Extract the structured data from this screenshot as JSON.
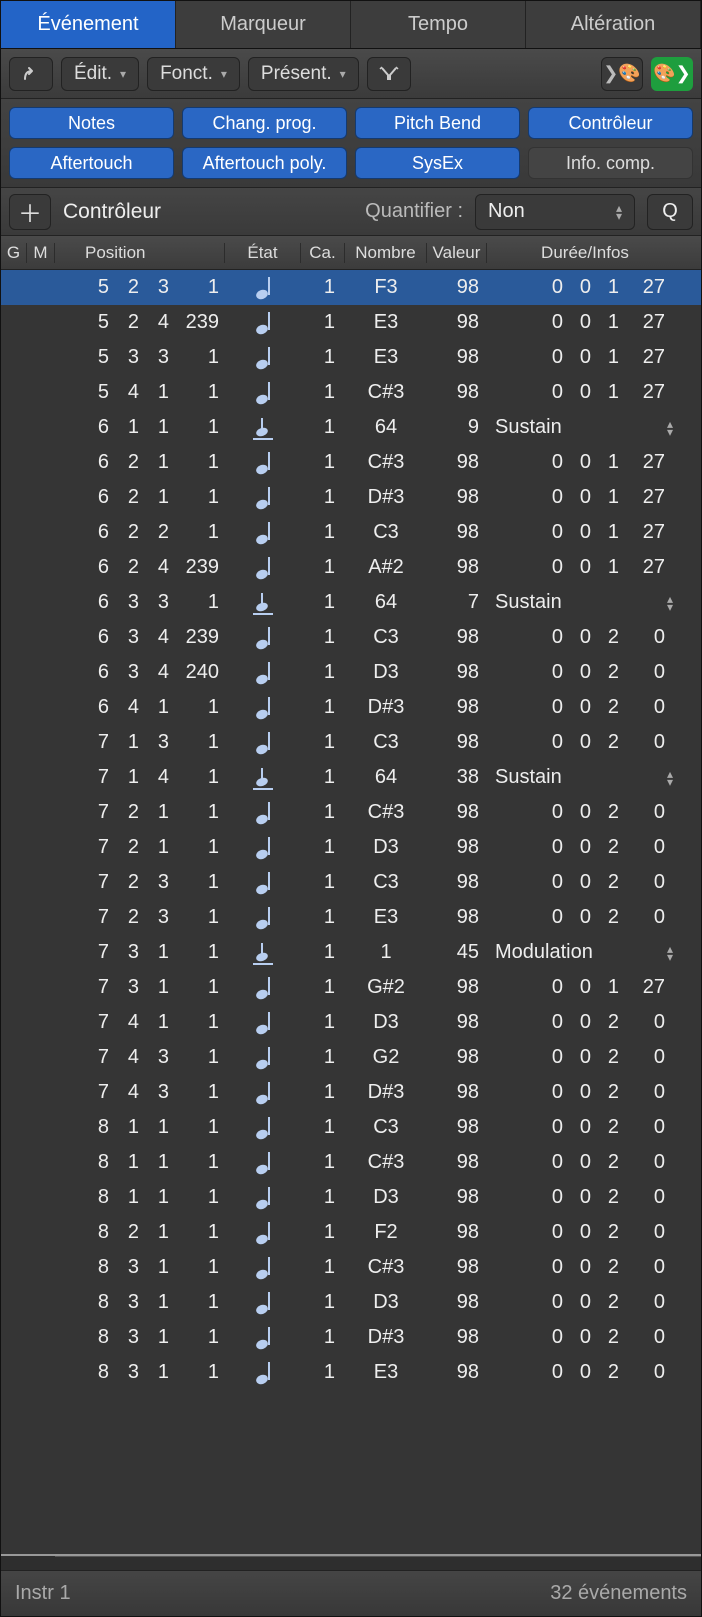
{
  "tabs": [
    "Événement",
    "Marqueur",
    "Tempo",
    "Altération"
  ],
  "toolbar": {
    "edit": "Édit.",
    "functions": "Fonct.",
    "present": "Présent."
  },
  "filters": {
    "notes": "Notes",
    "progchange": "Chang. prog.",
    "pitchbend": "Pitch Bend",
    "controller": "Contrôleur",
    "aftertouch": "Aftertouch",
    "polyafter": "Aftertouch poly.",
    "sysex": "SysEx",
    "infocomp": "Info. comp."
  },
  "add": {
    "type": "Contrôleur",
    "quant_label": "Quantifier :",
    "quant_value": "Non",
    "q": "Q"
  },
  "headers": {
    "g": "G",
    "m": "M",
    "pos": "Position",
    "etat": "État",
    "ca": "Ca.",
    "nom": "Nombre",
    "val": "Valeur",
    "dur": "Durée/Infos"
  },
  "events": [
    {
      "sel": true,
      "pos": [
        "5",
        "2",
        "3",
        "1"
      ],
      "type": "note",
      "ca": "1",
      "nom": "F3",
      "val": "98",
      "dur": [
        "0",
        "0",
        "1",
        "27"
      ]
    },
    {
      "pos": [
        "5",
        "2",
        "4",
        "239"
      ],
      "type": "note",
      "ca": "1",
      "nom": "E3",
      "val": "98",
      "dur": [
        "0",
        "0",
        "1",
        "27"
      ]
    },
    {
      "pos": [
        "5",
        "3",
        "3",
        "1"
      ],
      "type": "note",
      "ca": "1",
      "nom": "E3",
      "val": "98",
      "dur": [
        "0",
        "0",
        "1",
        "27"
      ]
    },
    {
      "pos": [
        "5",
        "4",
        "1",
        "1"
      ],
      "type": "note",
      "ca": "1",
      "nom": "C#3",
      "val": "98",
      "dur": [
        "0",
        "0",
        "1",
        "27"
      ]
    },
    {
      "pos": [
        "6",
        "1",
        "1",
        "1"
      ],
      "type": "ctrl",
      "ca": "1",
      "nom": "64",
      "val": "9",
      "info": "Sustain"
    },
    {
      "pos": [
        "6",
        "2",
        "1",
        "1"
      ],
      "type": "note",
      "ca": "1",
      "nom": "C#3",
      "val": "98",
      "dur": [
        "0",
        "0",
        "1",
        "27"
      ]
    },
    {
      "pos": [
        "6",
        "2",
        "1",
        "1"
      ],
      "type": "note",
      "ca": "1",
      "nom": "D#3",
      "val": "98",
      "dur": [
        "0",
        "0",
        "1",
        "27"
      ]
    },
    {
      "pos": [
        "6",
        "2",
        "2",
        "1"
      ],
      "type": "note",
      "ca": "1",
      "nom": "C3",
      "val": "98",
      "dur": [
        "0",
        "0",
        "1",
        "27"
      ]
    },
    {
      "pos": [
        "6",
        "2",
        "4",
        "239"
      ],
      "type": "note",
      "ca": "1",
      "nom": "A#2",
      "val": "98",
      "dur": [
        "0",
        "0",
        "1",
        "27"
      ]
    },
    {
      "pos": [
        "6",
        "3",
        "3",
        "1"
      ],
      "type": "ctrl",
      "ca": "1",
      "nom": "64",
      "val": "7",
      "info": "Sustain"
    },
    {
      "pos": [
        "6",
        "3",
        "4",
        "239"
      ],
      "type": "note",
      "ca": "1",
      "nom": "C3",
      "val": "98",
      "dur": [
        "0",
        "0",
        "2",
        "0"
      ]
    },
    {
      "pos": [
        "6",
        "3",
        "4",
        "240"
      ],
      "type": "note",
      "ca": "1",
      "nom": "D3",
      "val": "98",
      "dur": [
        "0",
        "0",
        "2",
        "0"
      ]
    },
    {
      "pos": [
        "6",
        "4",
        "1",
        "1"
      ],
      "type": "note",
      "ca": "1",
      "nom": "D#3",
      "val": "98",
      "dur": [
        "0",
        "0",
        "2",
        "0"
      ]
    },
    {
      "pos": [
        "7",
        "1",
        "3",
        "1"
      ],
      "type": "note",
      "ca": "1",
      "nom": "C3",
      "val": "98",
      "dur": [
        "0",
        "0",
        "2",
        "0"
      ]
    },
    {
      "pos": [
        "7",
        "1",
        "4",
        "1"
      ],
      "type": "ctrl",
      "ca": "1",
      "nom": "64",
      "val": "38",
      "info": "Sustain"
    },
    {
      "pos": [
        "7",
        "2",
        "1",
        "1"
      ],
      "type": "note",
      "ca": "1",
      "nom": "C#3",
      "val": "98",
      "dur": [
        "0",
        "0",
        "2",
        "0"
      ]
    },
    {
      "pos": [
        "7",
        "2",
        "1",
        "1"
      ],
      "type": "note",
      "ca": "1",
      "nom": "D3",
      "val": "98",
      "dur": [
        "0",
        "0",
        "2",
        "0"
      ]
    },
    {
      "pos": [
        "7",
        "2",
        "3",
        "1"
      ],
      "type": "note",
      "ca": "1",
      "nom": "C3",
      "val": "98",
      "dur": [
        "0",
        "0",
        "2",
        "0"
      ]
    },
    {
      "pos": [
        "7",
        "2",
        "3",
        "1"
      ],
      "type": "note",
      "ca": "1",
      "nom": "E3",
      "val": "98",
      "dur": [
        "0",
        "0",
        "2",
        "0"
      ]
    },
    {
      "pos": [
        "7",
        "3",
        "1",
        "1"
      ],
      "type": "ctrl",
      "ca": "1",
      "nom": "1",
      "val": "45",
      "info": "Modulation"
    },
    {
      "pos": [
        "7",
        "3",
        "1",
        "1"
      ],
      "type": "note",
      "ca": "1",
      "nom": "G#2",
      "val": "98",
      "dur": [
        "0",
        "0",
        "1",
        "27"
      ]
    },
    {
      "pos": [
        "7",
        "4",
        "1",
        "1"
      ],
      "type": "note",
      "ca": "1",
      "nom": "D3",
      "val": "98",
      "dur": [
        "0",
        "0",
        "2",
        "0"
      ]
    },
    {
      "pos": [
        "7",
        "4",
        "3",
        "1"
      ],
      "type": "note",
      "ca": "1",
      "nom": "G2",
      "val": "98",
      "dur": [
        "0",
        "0",
        "2",
        "0"
      ]
    },
    {
      "pos": [
        "7",
        "4",
        "3",
        "1"
      ],
      "type": "note",
      "ca": "1",
      "nom": "D#3",
      "val": "98",
      "dur": [
        "0",
        "0",
        "2",
        "0"
      ]
    },
    {
      "pos": [
        "8",
        "1",
        "1",
        "1"
      ],
      "type": "note",
      "ca": "1",
      "nom": "C3",
      "val": "98",
      "dur": [
        "0",
        "0",
        "2",
        "0"
      ]
    },
    {
      "pos": [
        "8",
        "1",
        "1",
        "1"
      ],
      "type": "note",
      "ca": "1",
      "nom": "C#3",
      "val": "98",
      "dur": [
        "0",
        "0",
        "2",
        "0"
      ]
    },
    {
      "pos": [
        "8",
        "1",
        "1",
        "1"
      ],
      "type": "note",
      "ca": "1",
      "nom": "D3",
      "val": "98",
      "dur": [
        "0",
        "0",
        "2",
        "0"
      ]
    },
    {
      "pos": [
        "8",
        "2",
        "1",
        "1"
      ],
      "type": "note",
      "ca": "1",
      "nom": "F2",
      "val": "98",
      "dur": [
        "0",
        "0",
        "2",
        "0"
      ]
    },
    {
      "pos": [
        "8",
        "3",
        "1",
        "1"
      ],
      "type": "note",
      "ca": "1",
      "nom": "C#3",
      "val": "98",
      "dur": [
        "0",
        "0",
        "2",
        "0"
      ]
    },
    {
      "pos": [
        "8",
        "3",
        "1",
        "1"
      ],
      "type": "note",
      "ca": "1",
      "nom": "D3",
      "val": "98",
      "dur": [
        "0",
        "0",
        "2",
        "0"
      ]
    },
    {
      "pos": [
        "8",
        "3",
        "1",
        "1"
      ],
      "type": "note",
      "ca": "1",
      "nom": "D#3",
      "val": "98",
      "dur": [
        "0",
        "0",
        "2",
        "0"
      ]
    },
    {
      "pos": [
        "8",
        "3",
        "1",
        "1"
      ],
      "type": "note",
      "ca": "1",
      "nom": "E3",
      "val": "98",
      "dur": [
        "0",
        "0",
        "2",
        "0"
      ]
    }
  ],
  "footer": {
    "track": "Instr 1",
    "count": "32 événements"
  }
}
